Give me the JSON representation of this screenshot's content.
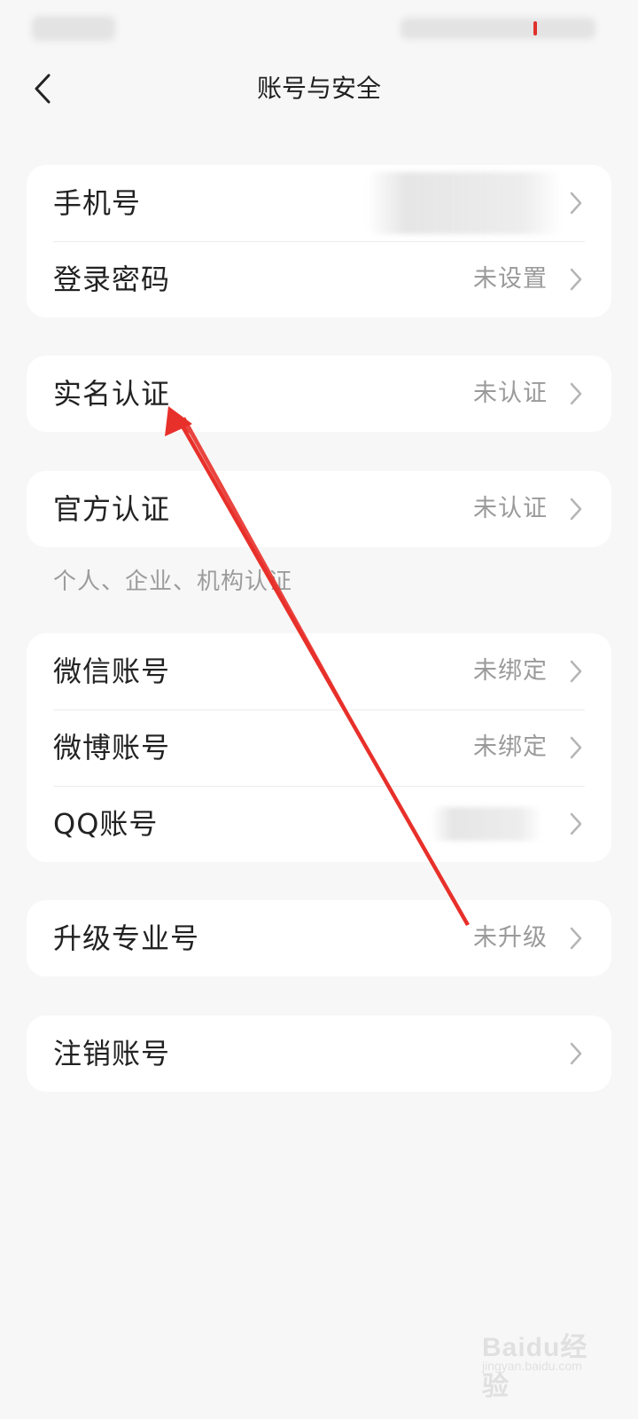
{
  "header": {
    "title": "账号与安全",
    "back_icon": "chevron-left-icon"
  },
  "groups": {
    "account": {
      "phone": {
        "label": "手机号",
        "value": ""
      },
      "password": {
        "label": "登录密码",
        "value": "未设置"
      }
    },
    "realname": {
      "label": "实名认证",
      "value": "未认证"
    },
    "official": {
      "label": "官方认证",
      "value": "未认证",
      "note": "个人、企业、机构认证"
    },
    "bindings": {
      "wechat": {
        "label": "微信账号",
        "value": "未绑定"
      },
      "weibo": {
        "label": "微博账号",
        "value": "未绑定"
      },
      "qq": {
        "label": "QQ账号",
        "value": ""
      }
    },
    "upgrade": {
      "label": "升级专业号",
      "value": "未升级"
    },
    "cancel": {
      "label": "注销账号",
      "value": ""
    }
  },
  "annotation": {
    "color": "#e8302a"
  },
  "watermark": {
    "brand": "Baidu经验",
    "sub": "jingyan.baidu.com"
  },
  "colors": {
    "background": "#f7f7f7",
    "card": "#ffffff",
    "secondary_text": "#9a9a9a"
  }
}
